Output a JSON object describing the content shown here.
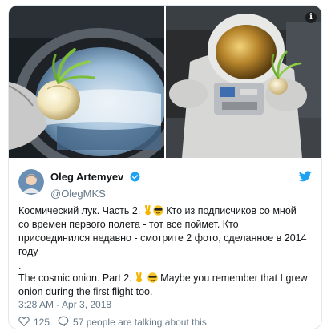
{
  "tweet": {
    "author": {
      "display_name": "Oleg Artemyev",
      "handle": "@OlegMKS",
      "verified": true,
      "avatar_icon": "astronaut-avatar"
    },
    "text": {
      "ru": "Космический лук. Часть 2. ",
      "ru_after_emoji": " Кто из подписчиков со мной со времен первого полета - тот все поймет. Кто присоединился недавно - смотрите 2 фото, сделанное в 2014 году ",
      "dot": ".",
      "en_before": "The cosmic onion. Part 2. ",
      "en_after": " Maybe you remember that I grew onion during the first flight too."
    },
    "timestamp": "3:28 AM - Apr 3, 2018",
    "likes_count": "125",
    "talking_text": "57 people are talking about this",
    "media": [
      {
        "icon": "onion-in-window-photo"
      },
      {
        "icon": "onion-and-spacesuit-photo"
      }
    ]
  },
  "colors": {
    "twitter_blue": "#1da1f2",
    "text": "#14171a",
    "muted": "#657786",
    "border": "#e1e8ed"
  }
}
